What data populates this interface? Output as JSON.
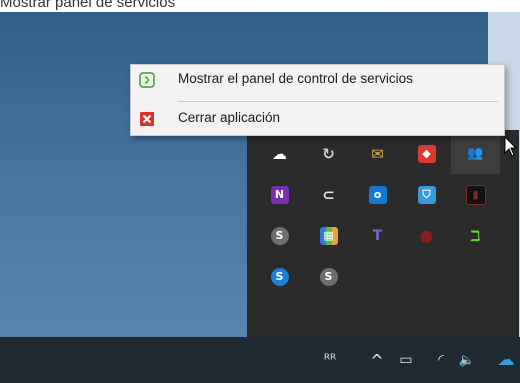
{
  "top_strip": {
    "text": "Mostrar panel de servicios"
  },
  "context_menu": {
    "items": [
      {
        "label": "Mostrar el panel de control de servicios",
        "icon": "services-panel-icon"
      },
      {
        "label": "Cerrar aplicación",
        "icon": "close-app-icon"
      }
    ]
  },
  "tray": {
    "icons": [
      {
        "name": "onedrive-info-icon",
        "glyph": "☁"
      },
      {
        "name": "recycle-icon",
        "glyph": "↻"
      },
      {
        "name": "mail-icon",
        "glyph": "✉"
      },
      {
        "name": "anydesk-icon",
        "glyph": "◆"
      },
      {
        "name": "teams-people-icon",
        "glyph": "👥"
      },
      {
        "name": "onenote-icon",
        "glyph": "N"
      },
      {
        "name": "usb-drive-icon",
        "glyph": "⊂"
      },
      {
        "name": "outlook-icon",
        "glyph": "o"
      },
      {
        "name": "defender-shield-icon",
        "glyph": "⛉"
      },
      {
        "name": "dark-app-icon",
        "glyph": "▮"
      },
      {
        "name": "skype-gray-icon",
        "glyph": "S"
      },
      {
        "name": "color-blocks-icon",
        "glyph": "▦"
      },
      {
        "name": "teams-icon",
        "glyph": "T"
      },
      {
        "name": "red-circle-icon",
        "glyph": "●"
      },
      {
        "name": "green-app-icon",
        "glyph": "ℶ"
      },
      {
        "name": "skype-business-icon",
        "glyph": "S"
      },
      {
        "name": "skype-gray-2-icon",
        "glyph": "S"
      }
    ]
  },
  "taskbar": {
    "people": "ᴿᴿ",
    "chevron": "^",
    "battery": "▭",
    "wifi": "◜",
    "volume": "🔈",
    "cloud": "☁"
  },
  "colors": {
    "menu_bg": "#f2f2f2",
    "tray_bg": "#2b2b2b",
    "taskbar_bg": "#1f2a33"
  }
}
